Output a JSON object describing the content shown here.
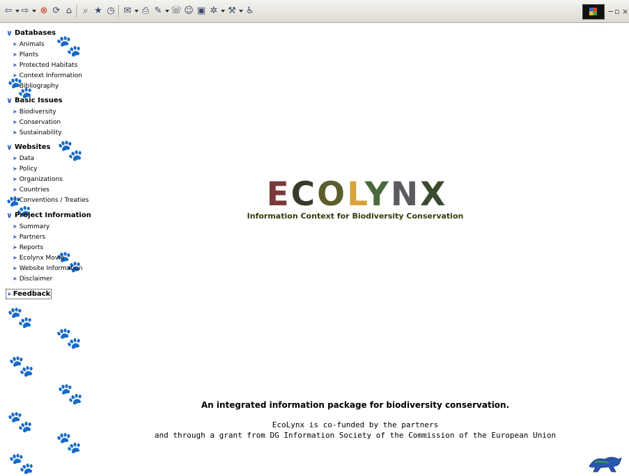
{
  "toolbar": {
    "icons": [
      "back-arrow-icon",
      "forward-arrow-icon",
      "stop-icon",
      "refresh-icon",
      "home-icon",
      "search-icon",
      "favorites-icon",
      "history-icon",
      "mail-icon",
      "print-icon",
      "edit-icon",
      "discuss-icon",
      "messenger-icon",
      "maximize-icon",
      "encoding-icon",
      "tools-icon",
      "accessibility-icon"
    ],
    "window_buttons": [
      "−",
      "▫",
      "×"
    ]
  },
  "sidebar": {
    "sections": [
      {
        "title": "Databases",
        "items": [
          "Animals",
          "Plants",
          "Protected Habitats",
          "Context Information",
          "Bibliography"
        ]
      },
      {
        "title": "Basic Issues",
        "items": [
          "Biodiversity",
          "Conservation",
          "Sustainability"
        ]
      },
      {
        "title": "Websites",
        "items": [
          "Data",
          "Policy",
          "Organizations",
          "Countries",
          "Conventions / Treaties"
        ]
      },
      {
        "title": "Project Information",
        "items": [
          "Summary",
          "Partners",
          "Reports",
          "Ecolynx Movie",
          "Website Information",
          "Disclaimer"
        ]
      }
    ],
    "feedback_label": "Feedback"
  },
  "main": {
    "logo_letters": [
      "E",
      "C",
      "O",
      "L",
      "Y",
      "N",
      "X"
    ],
    "logo_colors": [
      "#7a3a3a",
      "#3a3a2c",
      "#5c5c2c",
      "#d8a43a",
      "#4a6a3c",
      "#5a5c60",
      "#3a4a2e"
    ],
    "subtitle": "Information Context for Biodiversity Conservation",
    "tagline": "An integrated information package for biodiversity conservation.",
    "credit_line_1": "EcoLynx is co-funded by the partners",
    "credit_line_2": "and through a grant from DG Information Society of the Commission of the European Union"
  }
}
